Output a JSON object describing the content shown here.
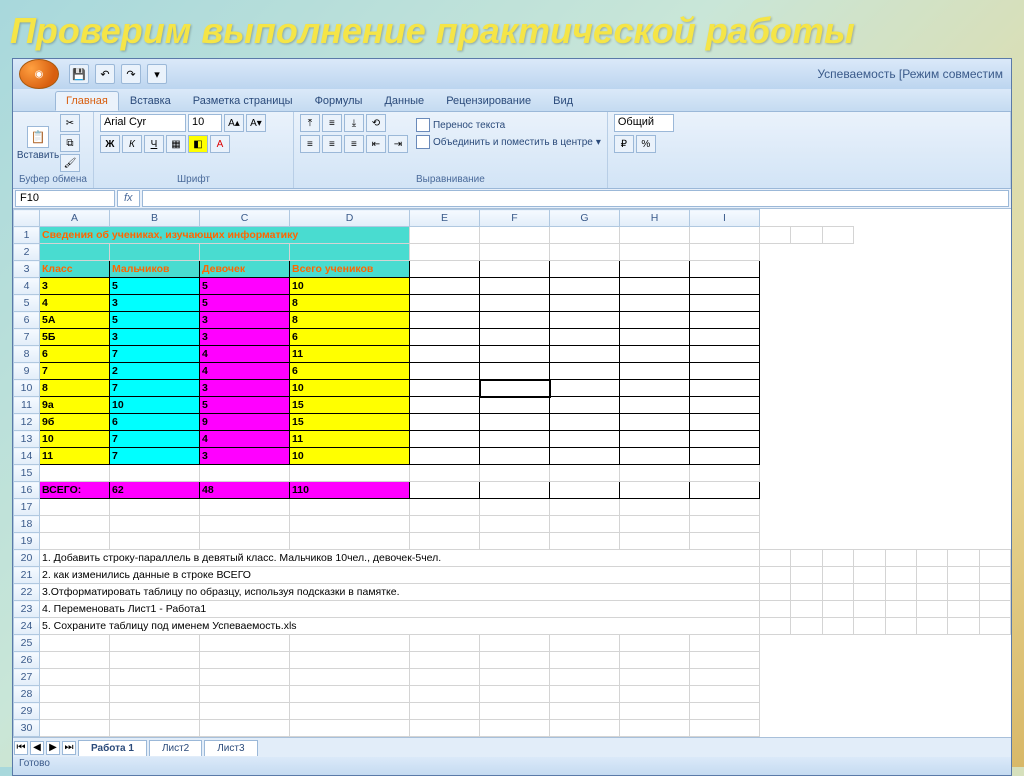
{
  "slide_title": "Проверим выполнение практической работы",
  "window_title": "Успеваемость  [Режим совместим",
  "ribbon": {
    "tabs": [
      "Главная",
      "Вставка",
      "Разметка страницы",
      "Формулы",
      "Данные",
      "Рецензирование",
      "Вид"
    ],
    "active_tab_index": 0,
    "groups": {
      "clipboard": {
        "label": "Буфер обмена",
        "paste": "Вставить"
      },
      "font": {
        "label": "Шрифт",
        "name": "Arial Cyr",
        "size": "10",
        "bold": "Ж",
        "italic": "К",
        "underline": "Ч"
      },
      "alignment": {
        "label": "Выравнивание",
        "wrap": "Перенос текста",
        "merge": "Объединить и поместить в центре"
      },
      "number": {
        "label": "",
        "general": "Общий"
      }
    }
  },
  "name_box": "F10",
  "fx_label": "fx",
  "columns": [
    "A",
    "B",
    "C",
    "D",
    "E",
    "F",
    "G",
    "H",
    "I"
  ],
  "selected_cell": {
    "row": 10,
    "col": "F"
  },
  "title_row": "Сведения об учениках, изучающих информатику",
  "headers": {
    "klass": "Класс",
    "boys": "Мальчиков",
    "girls": "Девочек",
    "total": "Всего учеников"
  },
  "rows": [
    {
      "klass": "3",
      "boys": "5",
      "girls": "5",
      "total": "10"
    },
    {
      "klass": "4",
      "boys": "3",
      "girls": "5",
      "total": "8"
    },
    {
      "klass": "5А",
      "boys": "5",
      "girls": "3",
      "total": "8"
    },
    {
      "klass": "5Б",
      "boys": "3",
      "girls": "3",
      "total": "6"
    },
    {
      "klass": "6",
      "boys": "7",
      "girls": "4",
      "total": "11"
    },
    {
      "klass": "7",
      "boys": "2",
      "girls": "4",
      "total": "6"
    },
    {
      "klass": "8",
      "boys": "7",
      "girls": "3",
      "total": "10"
    },
    {
      "klass": "9а",
      "boys": "10",
      "girls": "5",
      "total": "15"
    },
    {
      "klass": "9б",
      "boys": "6",
      "girls": "9",
      "total": "15"
    },
    {
      "klass": "10",
      "boys": "7",
      "girls": "4",
      "total": "11"
    },
    {
      "klass": "11",
      "boys": "7",
      "girls": "3",
      "total": "10"
    }
  ],
  "totals": {
    "label": "ВСЕГО:",
    "boys": "62",
    "girls": "48",
    "total": "110"
  },
  "instructions": [
    "1. Добавить строку-параллель в девятый  класс. Мальчиков 10чел., девочек-5чел.",
    "2. как изменились данные в строке ВСЕГО",
    "3.Отформатировать таблицу по образцу, используя подсказки в памятке.",
    "4. Переменовать Лист1 -  Работа1",
    "5.  Сохраните таблицу под именем Успеваемость.xls"
  ],
  "sheets": [
    "Работа 1",
    "Лист2",
    "Лист3"
  ],
  "active_sheet_index": 0,
  "status": "Готово"
}
